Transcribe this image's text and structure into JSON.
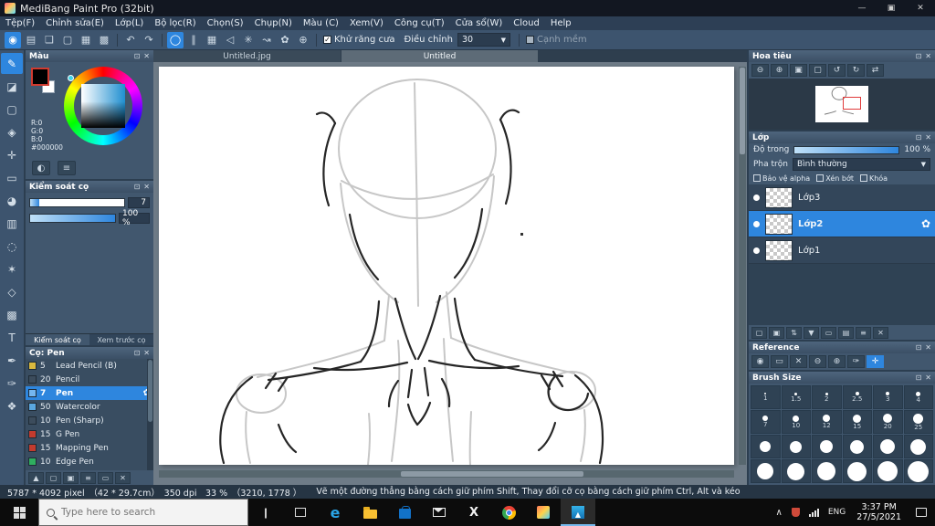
{
  "window": {
    "title": "MediBang Paint Pro (32bit)"
  },
  "menu": {
    "items": [
      "Tệp(F)",
      "Chỉnh sửa(E)",
      "Lớp(L)",
      "Bộ lọc(R)",
      "Chọn(S)",
      "Chụp(N)",
      "Màu (C)",
      "Xem(V)",
      "Công cụ(T)",
      "Cửa sổ(W)",
      "Cloud",
      "Help"
    ]
  },
  "toolbar": {
    "antialias": "Khử răng cưa",
    "adjust_label": "Điều chỉnh",
    "adjust_value": "30",
    "soft_edge": "Cạnh mềm"
  },
  "color_panel": {
    "title": "Màu",
    "r": "R:0",
    "g": "G:0",
    "b": "B:0",
    "hex": "#000000"
  },
  "brush_control": {
    "title": "Kiểm soát cọ",
    "size_value": "7",
    "opacity_value": "100 %",
    "tab1": "Kiểm soát cọ",
    "tab2": "Xem trước cọ"
  },
  "brush_panel": {
    "title": "Cọ: Pen",
    "brushes": [
      {
        "size": "5",
        "name": "Lead Pencil (B)"
      },
      {
        "size": "20",
        "name": "Pencil"
      },
      {
        "size": "7",
        "name": "Pen"
      },
      {
        "size": "50",
        "name": "Watercolor"
      },
      {
        "size": "10",
        "name": "Pen (Sharp)"
      },
      {
        "size": "15",
        "name": "G Pen"
      },
      {
        "size": "15",
        "name": "Mapping Pen"
      },
      {
        "size": "10",
        "name": "Edge Pen"
      }
    ]
  },
  "documents": {
    "tab1": "Untitled.jpg",
    "tab2": "Untitled"
  },
  "navigator": {
    "title": "Hoa tiêu"
  },
  "layers": {
    "title": "Lớp",
    "opacity_label": "Độ trong",
    "opacity_value": "100 %",
    "blend_label": "Pha trộn",
    "blend_value": "Bình thường",
    "check1": "Bảo vệ alpha",
    "check2": "Xén bớt",
    "check3": "Khóa",
    "items": [
      {
        "name": "Lớp3"
      },
      {
        "name": "Lớp2"
      },
      {
        "name": "Lớp1"
      }
    ]
  },
  "reference": {
    "title": "Reference"
  },
  "brush_size": {
    "title": "Brush Size",
    "labels_row1": [
      "1",
      "1.5",
      "2",
      "2.5",
      "3",
      "4"
    ],
    "labels_row2": [
      "7",
      "10",
      "12",
      "15",
      "20",
      "25"
    ]
  },
  "status": {
    "info": "5787 * 4092 pixel　（42 * 29.7cm）　350 dpi　33 %　（3210, 1778 ）",
    "hint": "Vẽ một đường thẳng bằng cách giữ phím Shift, Thay đổi cỡ cọ bằng cách giữ phím Ctrl, Alt và kéo"
  },
  "taskbar": {
    "search_placeholder": "Type here to search",
    "language": "ENG",
    "time": "3:37 PM",
    "date": "27/5/2021"
  },
  "colors": {
    "accent": "#2e86de",
    "selection_blue": "#2e86de",
    "foreground_swatch": "#000000",
    "brush_icon_colors": [
      "#d9b83e",
      "#3c4c5c",
      "#74b6f0",
      "#5aa7e0",
      "#3c4c5c",
      "#c23b2e",
      "#c23b2e",
      "#2fae5f"
    ],
    "navigator_viewport": "#e03a3a",
    "taskbar_underline": "#76b9ed"
  }
}
